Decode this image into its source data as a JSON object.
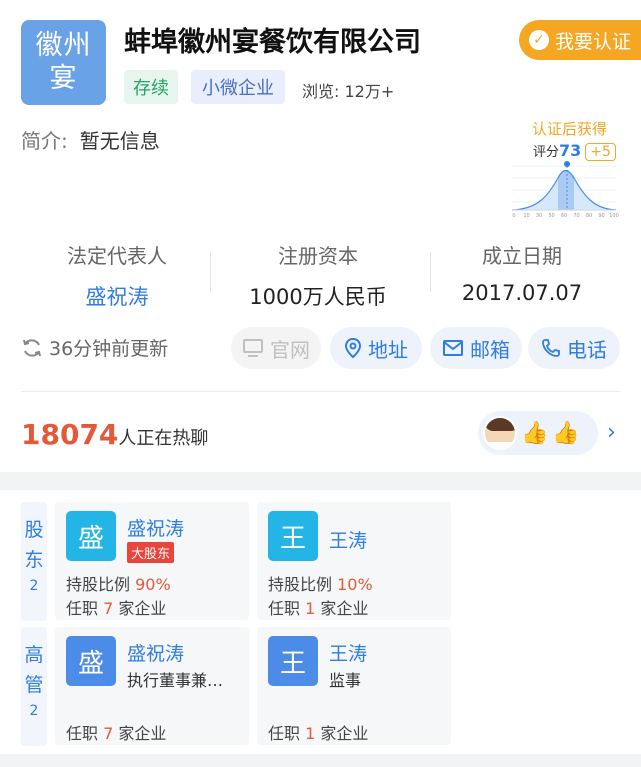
{
  "header": {
    "logo_text": "徽州\n宴",
    "company_name": "蚌埠徽州宴餐饮有限公司",
    "certify_label": "我要认证",
    "tags": [
      "存续",
      "小微企业"
    ],
    "views": "浏览: 12万+"
  },
  "intro": {
    "label": "简介:",
    "value": "暂无信息"
  },
  "rating": {
    "title": "认证后获得",
    "score_label": "评分",
    "score": "73",
    "bonus": "+5",
    "axis_ticks": [
      "0",
      "10",
      "30",
      "50",
      "60",
      "70",
      "80",
      "90",
      "100"
    ]
  },
  "info": {
    "legal_rep_label": "法定代表人",
    "legal_rep": "盛祝涛",
    "capital_label": "注册资本",
    "capital": "1000万人民币",
    "founded_label": "成立日期",
    "founded": "2017.07.07"
  },
  "actions": {
    "updated": "36分钟前更新",
    "website": "官网",
    "address": "地址",
    "email": "邮箱",
    "phone": "电话"
  },
  "chat": {
    "count": "18074",
    "text": "人正在热聊"
  },
  "shareholders": {
    "tab_label": "股东",
    "count": "2",
    "items": [
      {
        "avatar": "盛",
        "name": "盛祝涛",
        "badge": "大股东",
        "ratio_label": "持股比例",
        "ratio": "90%",
        "jobs_prefix": "任职",
        "jobs": "7",
        "jobs_suffix": "家企业"
      },
      {
        "avatar": "王",
        "name": "王涛",
        "ratio_label": "持股比例",
        "ratio": "10%",
        "jobs_prefix": "任职",
        "jobs": "1",
        "jobs_suffix": "家企业"
      }
    ]
  },
  "executives": {
    "tab_label": "高管",
    "count": "2",
    "items": [
      {
        "avatar": "盛",
        "name": "盛祝涛",
        "role": "执行董事兼…",
        "jobs_prefix": "任职",
        "jobs": "7",
        "jobs_suffix": "家企业"
      },
      {
        "avatar": "王",
        "name": "王涛",
        "role": "监事",
        "jobs_prefix": "任职",
        "jobs": "1",
        "jobs_suffix": "家企业"
      }
    ]
  },
  "colors": {
    "accent": "#2f7de1",
    "orange": "#f5a623",
    "red": "#e25a3a"
  }
}
